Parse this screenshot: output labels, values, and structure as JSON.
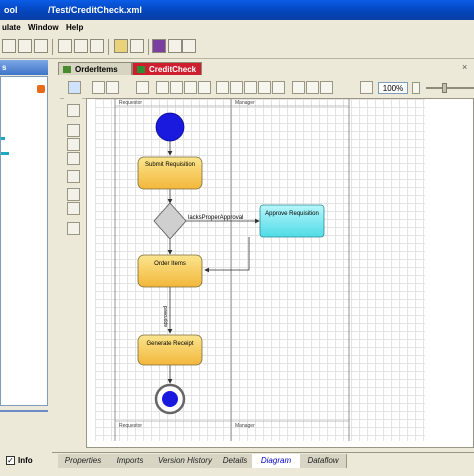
{
  "window": {
    "title_left": "ool",
    "title_path": "/Test/CreditCheck.xml"
  },
  "menu": {
    "items": [
      "ulate",
      "Window",
      "Help"
    ]
  },
  "left_panel": {
    "tab_label": "s",
    "info_label": "Info"
  },
  "editor": {
    "tabs": [
      {
        "label": "OrderItems"
      },
      {
        "label": "CreditCheck"
      }
    ]
  },
  "diagram_toolbar": {
    "zoom_value": "100%"
  },
  "diagram": {
    "lane_left_label": "Requestor",
    "lane_right_label": "Manager",
    "nodes": {
      "submit": "Submit Requisition",
      "order": "Order Items",
      "approve": "Approve Requisition",
      "receipt": "Generate Receipt"
    },
    "edges": {
      "lacks_approval": "lacksProperApproval",
      "approved": "approved"
    }
  },
  "bottom_tabs": [
    "Properties",
    "Imports",
    "Version History",
    "Details",
    "Diagram",
    "Dataflow"
  ],
  "bottom_active": "Diagram",
  "colors": {
    "title_blue": "#0a5ce8",
    "start_node": "#1a1adf",
    "task_yellow": "#f5c54a",
    "task_cyan": "#6fe7f0"
  }
}
